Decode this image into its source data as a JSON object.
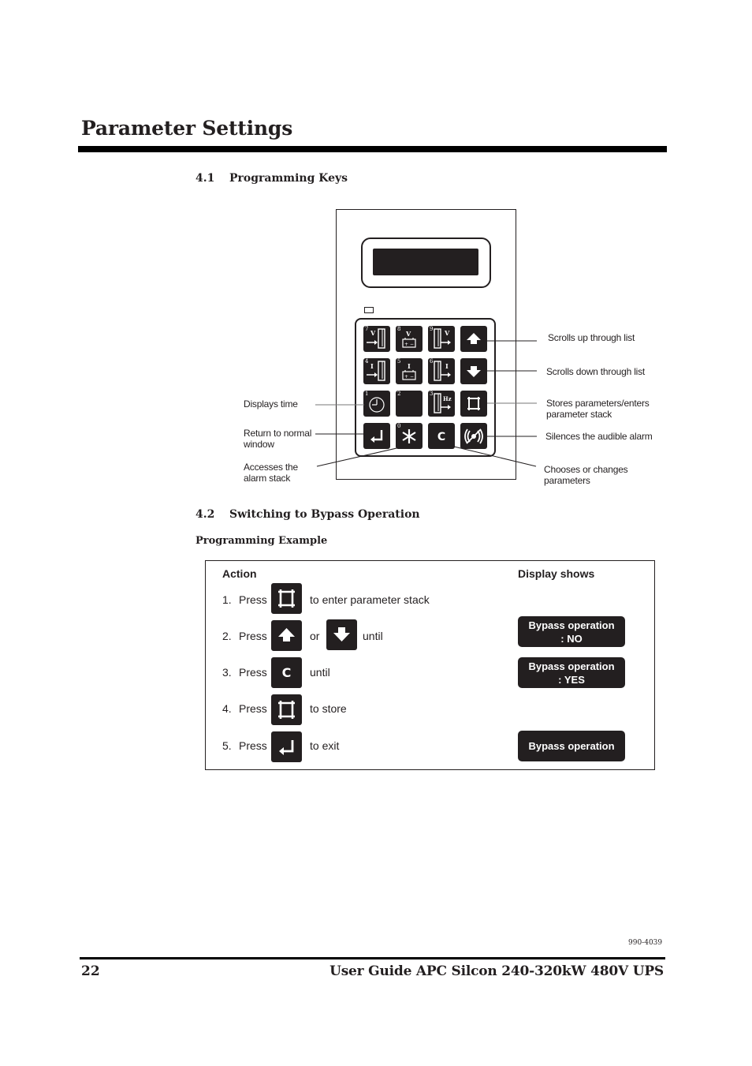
{
  "header": {
    "title": "Parameter Settings"
  },
  "section_4_1": {
    "number": "4.1",
    "title": "Programming Keys"
  },
  "keypad": {
    "keys": [
      {
        "id": "key-7",
        "number": "7",
        "icon": "voltage-input-icon",
        "symbol": "V"
      },
      {
        "id": "key-8",
        "number": "8",
        "icon": "battery-voltage-icon",
        "symbol": "V"
      },
      {
        "id": "key-9",
        "number": "9",
        "icon": "voltage-output-icon",
        "symbol": "V"
      },
      {
        "id": "key-up",
        "number": "",
        "icon": "arrow-up-icon",
        "symbol": ""
      },
      {
        "id": "key-4",
        "number": "4",
        "icon": "current-input-icon",
        "symbol": "I"
      },
      {
        "id": "key-5",
        "number": "5",
        "icon": "battery-current-icon",
        "symbol": "I"
      },
      {
        "id": "key-6",
        "number": "6",
        "icon": "current-output-icon",
        "symbol": "I"
      },
      {
        "id": "key-down",
        "number": "",
        "icon": "arrow-down-icon",
        "symbol": ""
      },
      {
        "id": "key-1",
        "number": "1",
        "icon": "clock-icon",
        "symbol": ""
      },
      {
        "id": "key-2",
        "number": "2",
        "icon": "",
        "symbol": ""
      },
      {
        "id": "key-3",
        "number": "3",
        "icon": "frequency-output-icon",
        "symbol": "Hz"
      },
      {
        "id": "key-store",
        "number": "",
        "icon": "parameter-stack-icon",
        "symbol": ""
      },
      {
        "id": "key-return",
        "number": "",
        "icon": "return-icon",
        "symbol": ""
      },
      {
        "id": "key-0",
        "number": "0",
        "icon": "asterisk-alarm-icon",
        "symbol": ""
      },
      {
        "id": "key-c",
        "number": "",
        "icon": "change-icon",
        "symbol": "C"
      },
      {
        "id": "key-silence",
        "number": "",
        "icon": "alarm-silence-icon",
        "symbol": ""
      }
    ],
    "callouts": {
      "scroll_up": "Scrolls up through list",
      "scroll_down": "Scrolls down through list",
      "stores_line1": "Stores parameters/enters",
      "stores_line2": "parameter stack",
      "silences": "Silences the audible alarm",
      "chooses_line1": "Chooses or changes",
      "chooses_line2": "parameters",
      "displays_time": "Displays time",
      "return_line1": "Return to normal",
      "return_line2": "window",
      "alarm_line1": "Accesses the",
      "alarm_line2": "alarm stack"
    }
  },
  "section_4_2": {
    "number": "4.2",
    "title": "Switching to Bypass Operation",
    "subtitle": "Programming Example"
  },
  "example": {
    "action_header": "Action",
    "display_header": "Display shows",
    "steps": [
      {
        "index": "1.",
        "verb": "Press",
        "keys": [
          "parameter-stack"
        ],
        "text": "to enter parameter stack"
      },
      {
        "index": "2.",
        "verb": "Press",
        "keys": [
          "arrow-up",
          "arrow-down"
        ],
        "joiner": "or",
        "text": "until"
      },
      {
        "index": "3.",
        "verb": "Press",
        "keys": [
          "change"
        ],
        "text": "until"
      },
      {
        "index": "4.",
        "verb": "Press",
        "keys": [
          "parameter-stack"
        ],
        "text": "to store"
      },
      {
        "index": "5.",
        "verb": "Press",
        "keys": [
          "return"
        ],
        "text": "to exit"
      }
    ],
    "key_c_label": "C",
    "displays": [
      {
        "line1": "Bypass operation",
        "line2": ": NO"
      },
      {
        "line1": "Bypass operation",
        "line2": ": YES"
      },
      {
        "line1": "Bypass operation",
        "line2": ""
      }
    ]
  },
  "footer": {
    "doc_number": "990-4039",
    "page_number": "22",
    "title": "User Guide APC Silcon 240-320kW 480V UPS"
  }
}
